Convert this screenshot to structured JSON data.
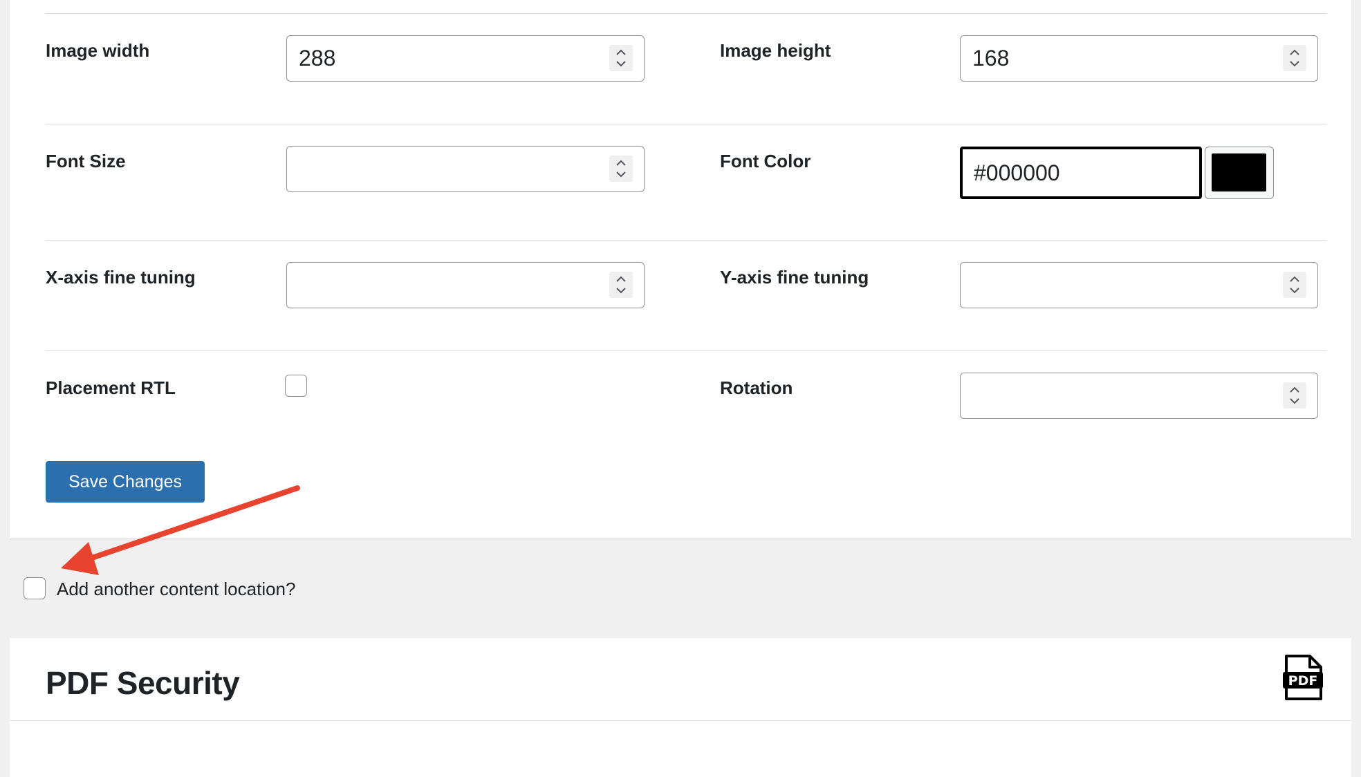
{
  "settings": {
    "image_width": {
      "label": "Image width",
      "value": "288"
    },
    "image_height": {
      "label": "Image height",
      "value": "168"
    },
    "font_size": {
      "label": "Font Size",
      "value": ""
    },
    "font_color": {
      "label": "Font Color",
      "value": "#000000",
      "swatch_color": "#000000"
    },
    "x_axis": {
      "label": "X-axis fine tuning",
      "value": ""
    },
    "y_axis": {
      "label": "Y-axis fine tuning",
      "value": ""
    },
    "placement_rtl": {
      "label": "Placement RTL",
      "checked": false
    },
    "rotation": {
      "label": "Rotation",
      "value": ""
    }
  },
  "save_button": {
    "label": "Save Changes",
    "color": "#2c6faf"
  },
  "add_location": {
    "label": "Add another content location?",
    "checked": false
  },
  "pdf_security": {
    "title": "PDF Security",
    "icon": "pdf-file-icon"
  },
  "annotation": {
    "arrow_color": "#e8432f",
    "icon": "red-arrow-annotation"
  }
}
